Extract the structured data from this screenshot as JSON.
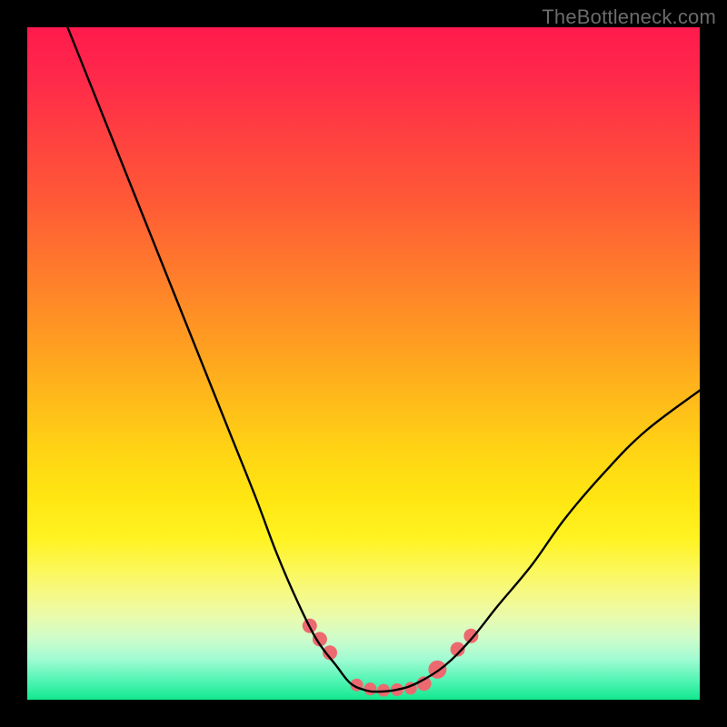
{
  "watermark": {
    "text": "TheBottleneck.com"
  },
  "colors": {
    "curve_stroke": "#000000",
    "marker_fill": "#ec6a6f",
    "marker_stroke": "#ec6a6f",
    "frame": "#000000"
  },
  "chart_data": {
    "type": "line",
    "title": "",
    "xlabel": "",
    "ylabel": "",
    "xlim": [
      0,
      100
    ],
    "ylim": [
      0,
      100
    ],
    "grid": false,
    "series": [
      {
        "name": "bottleneck-curve",
        "x": [
          6,
          10,
          14,
          18,
          22,
          26,
          30,
          34,
          37,
          40,
          43,
          46,
          48,
          50,
          52,
          55,
          58,
          62,
          66,
          70,
          75,
          80,
          86,
          92,
          100
        ],
        "values": [
          100,
          90,
          80,
          70,
          60,
          50,
          40,
          30,
          22,
          15,
          9,
          5,
          2.5,
          1.5,
          1.2,
          1.5,
          2.5,
          5,
          9,
          14,
          20,
          27,
          34,
          40,
          46
        ]
      }
    ],
    "markers": {
      "name": "highlight-dots",
      "x": [
        42,
        43.5,
        45,
        49,
        51,
        53,
        55,
        57,
        59,
        61,
        64,
        66
      ],
      "values": [
        11,
        9,
        7,
        2.2,
        1.6,
        1.4,
        1.5,
        1.7,
        2.4,
        4.5,
        7.5,
        9.5
      ],
      "radius": [
        8,
        8,
        8,
        7,
        7,
        7,
        7,
        7,
        8,
        10,
        8,
        8
      ]
    }
  }
}
